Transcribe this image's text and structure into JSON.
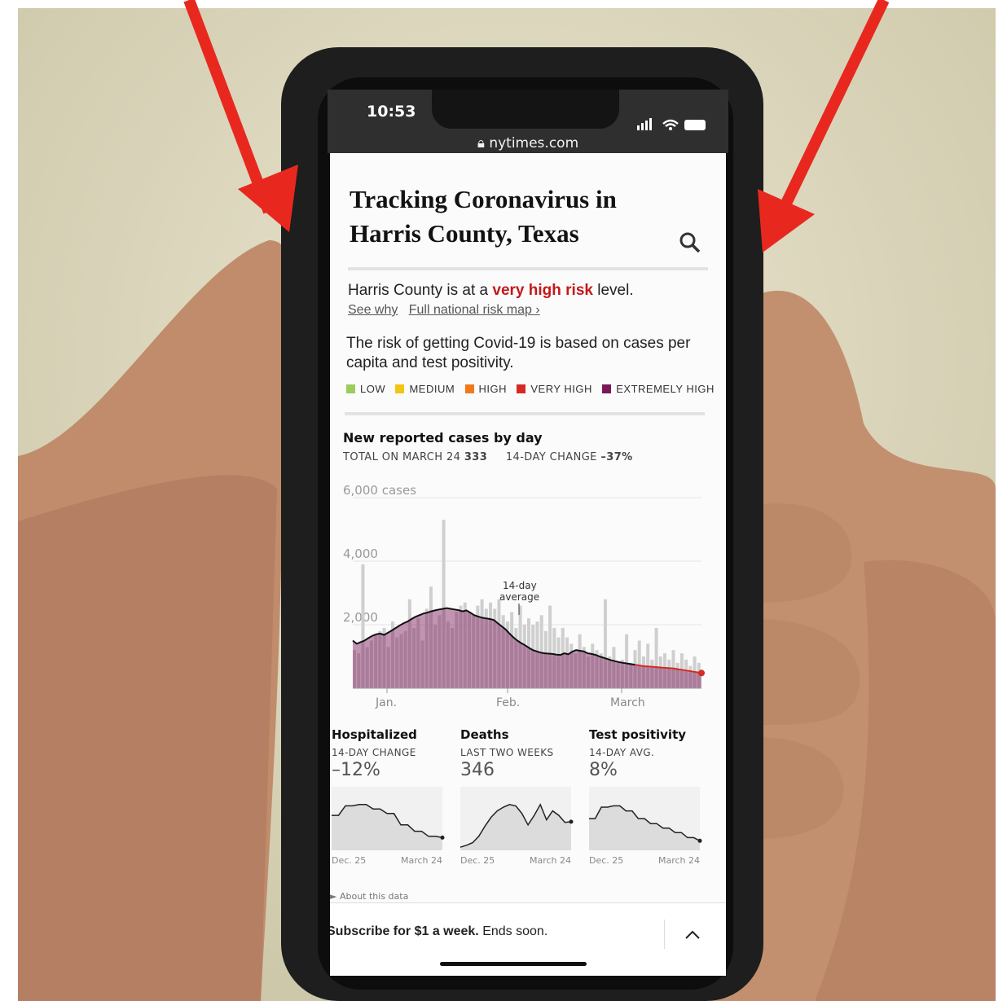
{
  "status_bar": {
    "time": "10:53",
    "url": "nytimes.com"
  },
  "article": {
    "title_line1": "Tracking Coronavirus in",
    "title_line2": "Harris County, Texas",
    "risk_prefix": "Harris County is at a",
    "risk_level": "very high risk",
    "risk_suffix": "level.",
    "link_see_why": "See why",
    "link_map": "Full national risk map ›",
    "risk_explainer": "The risk of getting Covid-19 is based on cases per capita and test positivity.",
    "legend": [
      {
        "label": "LOW",
        "color": "#9acd5a"
      },
      {
        "label": "MEDIUM",
        "color": "#f3c711"
      },
      {
        "label": "HIGH",
        "color": "#ee7a1b"
      },
      {
        "label": "VERY HIGH",
        "color": "#d42a23"
      },
      {
        "label": "EXTREMELY HIGH",
        "color": "#7a1858"
      }
    ]
  },
  "cases_chart": {
    "heading": "New reported cases by day",
    "total_label": "TOTAL ON MARCH 24",
    "total_value": "333",
    "change_label": "14-DAY CHANGE",
    "change_value": "–37%",
    "annotation_line1": "14-day",
    "annotation_line2": "average"
  },
  "chart_data": {
    "type": "bar",
    "ylabel": "6,000 cases",
    "ylim": [
      0,
      6000
    ],
    "yticks": [
      "6,000 cases",
      "4,000",
      "2,000"
    ],
    "xticks": [
      "Jan.",
      "Feb.",
      "March"
    ],
    "daily_cases": [
      1200,
      1100,
      3900,
      1300,
      1500,
      1700,
      1800,
      1900,
      1300,
      2100,
      1600,
      1700,
      1800,
      2800,
      1900,
      2200,
      1500,
      2500,
      3200,
      2000,
      2300,
      5300,
      2100,
      1900,
      2400,
      2600,
      2700,
      2400,
      2300,
      2600,
      2800,
      2500,
      2700,
      2500,
      2800,
      2300,
      2100,
      2400,
      1900,
      2600,
      2000,
      2200,
      2000,
      2100,
      2300,
      1800,
      2600,
      1900,
      1600,
      1900,
      1600,
      1400,
      1100,
      1700,
      1300,
      1000,
      1400,
      1200,
      1100,
      2800,
      1000,
      1300,
      800,
      900,
      1700,
      800,
      1200,
      1500,
      1000,
      1400,
      900,
      1900,
      1000,
      1100,
      900,
      1200,
      800,
      1100,
      900,
      700,
      1000,
      800
    ],
    "avg_14day": [
      1500,
      1400,
      1450,
      1500,
      1580,
      1650,
      1700,
      1720,
      1680,
      1750,
      1820,
      1900,
      1980,
      2050,
      2100,
      2180,
      2250,
      2300,
      2350,
      2380,
      2420,
      2450,
      2480,
      2500,
      2520,
      2500,
      2480,
      2460,
      2420,
      2450,
      2380,
      2300,
      2260,
      2220,
      2200,
      2180,
      2150,
      2050,
      1950,
      1850,
      1720,
      1600,
      1500,
      1420,
      1350,
      1270,
      1200,
      1160,
      1120,
      1100,
      1090,
      1080,
      1060,
      1050,
      1100,
      1070,
      1150,
      1200,
      1180,
      1160,
      1100,
      1080,
      1050,
      1000,
      960,
      920,
      880,
      850,
      820,
      800,
      780,
      760,
      740,
      720,
      700,
      690,
      680,
      670,
      660,
      650,
      640,
      630,
      620,
      600,
      580,
      560,
      540,
      520,
      500,
      480
    ],
    "risk_colors": {
      "high_phase": "#7a1858",
      "recent": "#d42a23"
    }
  },
  "mini_charts": [
    {
      "title": "Hospitalized",
      "sub": "14-DAY CHANGE",
      "value": "–12%",
      "start": "Dec. 25",
      "end": "March 24",
      "values": [
        55,
        55,
        70,
        70,
        72,
        72,
        65,
        65,
        58,
        58,
        40,
        40,
        30,
        30,
        22,
        22,
        20
      ]
    },
    {
      "title": "Deaths",
      "sub": "LAST TWO WEEKS",
      "value": "346",
      "start": "Dec. 25",
      "end": "March 24",
      "values": [
        5,
        8,
        12,
        22,
        38,
        52,
        62,
        68,
        72,
        70,
        58,
        40,
        55,
        72,
        48,
        62,
        55,
        44,
        45
      ]
    },
    {
      "title": "Test positivity",
      "sub": "14-DAY AVG.",
      "value": "8%",
      "start": "Dec. 25",
      "end": "March 24",
      "values": [
        50,
        50,
        68,
        68,
        70,
        70,
        62,
        62,
        50,
        50,
        42,
        42,
        35,
        35,
        28,
        28,
        20,
        20,
        15
      ]
    }
  ],
  "about_link": "► About this data",
  "subscribe": {
    "bold": "Subscribe for $1 a week.",
    "rest": "Ends soon."
  },
  "annotation_colors": {
    "arrow": "#e8281e"
  }
}
